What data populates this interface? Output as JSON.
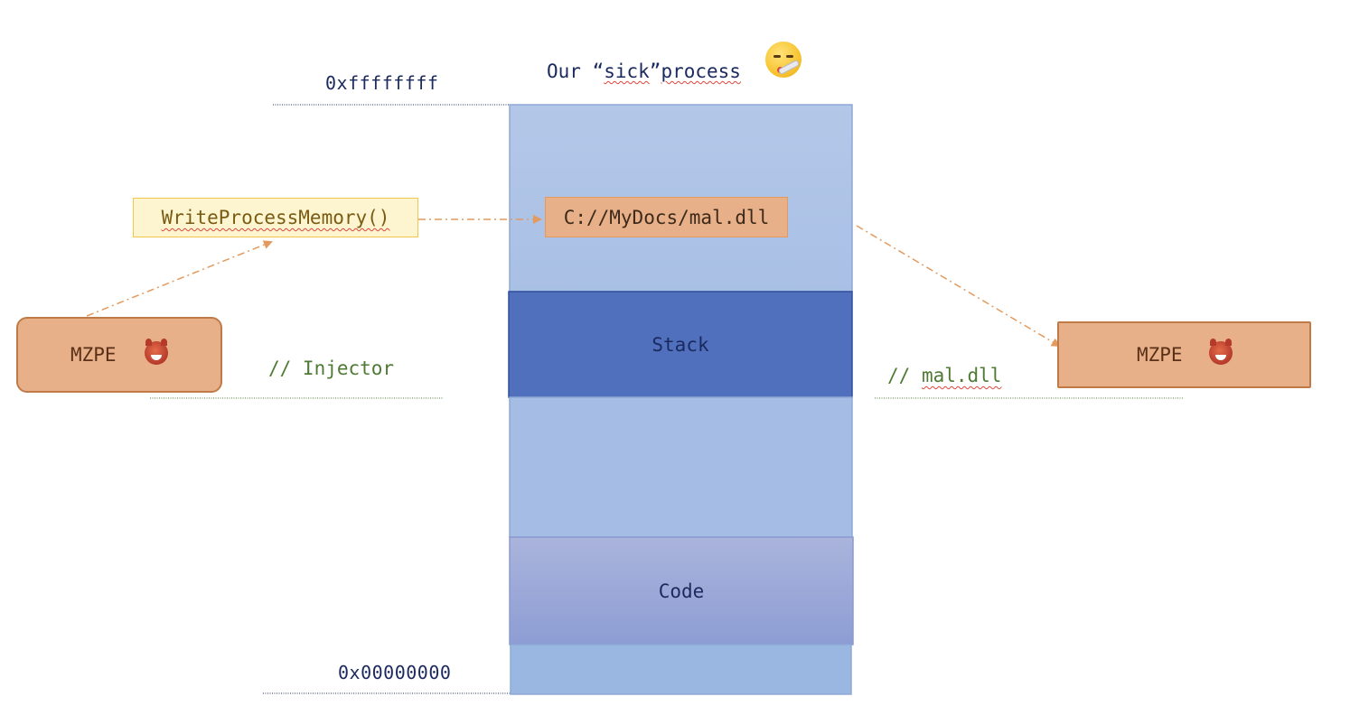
{
  "diagram": {
    "title": {
      "prefix": "Our “",
      "sick": "sick",
      "suffix_quote": "”",
      "process": "process"
    },
    "title_emoji": "sick-face-with-thermometer-icon",
    "address_top": "0xffffffff",
    "address_bottom": "0x00000000",
    "memory_segments": {
      "stack": "Stack",
      "code": "Code"
    },
    "injected_path": "C://MyDocs/mal.dll",
    "api_call": "WriteProcessMemory()",
    "injector": {
      "label": "MZPE",
      "icon": "devil-icon",
      "comment": "// Injector"
    },
    "payload": {
      "label": "MZPE",
      "icon": "devil-icon",
      "comment_prefix": "// ",
      "comment_word": "mal.dll"
    },
    "colors": {
      "process_fill": "#a8c0e4",
      "stack_fill": "#5070bd",
      "code_fill": "#9aa8d8",
      "orange_box": "#e8b088",
      "yellow_box": "#fdf5cf",
      "arrow": "#e39a5e",
      "navy_text": "#1b2a5e",
      "comment_text": "#4e7a34"
    }
  }
}
